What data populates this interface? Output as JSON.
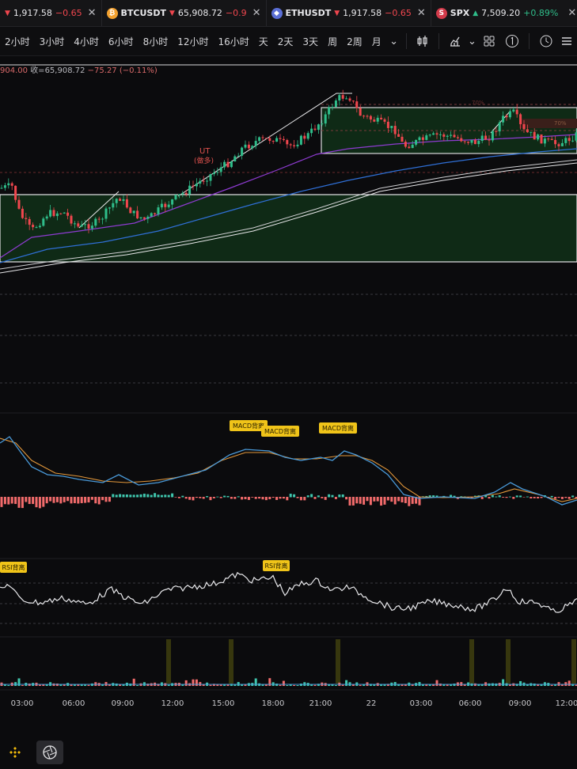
{
  "tabs": [
    {
      "symbol": "",
      "price": "1,917.58",
      "change": "−0.65",
      "dir": "down",
      "coin_color": ""
    },
    {
      "symbol": "BTCUSDT",
      "price": "65,908.72",
      "change": "−0.9",
      "dir": "down",
      "coin_color": "#f3a12f",
      "coin_glyph": "₿"
    },
    {
      "symbol": "ETHUSDT",
      "price": "1,917.58",
      "change": "−0.65",
      "dir": "down",
      "coin_color": "#5b6fd6",
      "coin_glyph": "◆"
    },
    {
      "symbol": "SPX",
      "price": "7,509.20",
      "change": "+0.89%",
      "dir": "up",
      "coin_color": "#d23a4a",
      "coin_glyph": "S"
    }
  ],
  "timeframes": [
    "2小时",
    "3小时",
    "4小时",
    "6小时",
    "8小时",
    "12小时",
    "16小时",
    "天",
    "2天",
    "3天",
    "周",
    "2周",
    "月"
  ],
  "toolbar_icons": [
    "chevron-down-icon",
    "candles-icon",
    "indicators-icon",
    "chevron-down-icon",
    "layout-grid-icon",
    "one-badge-icon",
    "alert-clock-icon",
    "menu-icon"
  ],
  "ohlc": {
    "prefix": "904.00",
    "close_label": "收=65,908.72",
    "change": "−75.27 (−0.11%)"
  },
  "annotations": {
    "ut": "UT",
    "ut_sub": "(做多)",
    "macd_tags": [
      "MACD背离",
      "MACD背离",
      "MACD背离"
    ],
    "rsi_tags": [
      "RSI背离",
      "RSI背离"
    ],
    "range_tags": [
      "70%",
      "70%"
    ]
  },
  "time_axis": [
    "03:00",
    "06:00",
    "09:00",
    "12:00",
    "15:00",
    "18:00",
    "21:00",
    "22",
    "03:00",
    "06:00",
    "09:00",
    "12:00"
  ],
  "colors": {
    "up": "#2fbd8a",
    "down": "#f0464e",
    "accent": "#f0c419",
    "box_fill": "#0f2a16"
  },
  "bottom_icons": [
    "binance-logo-icon",
    "aperture-icon"
  ]
}
